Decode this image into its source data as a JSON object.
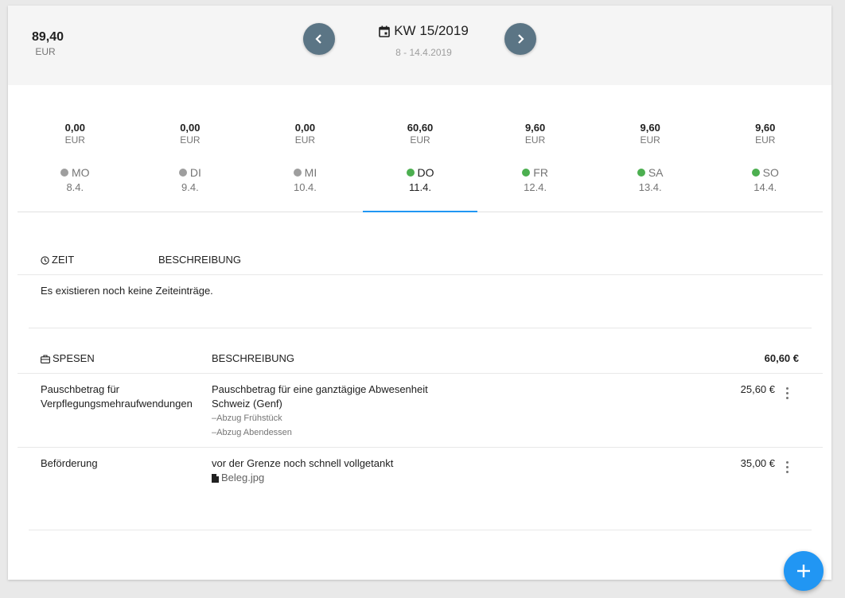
{
  "header": {
    "total_amount": "89,40",
    "total_currency": "EUR",
    "week_title": "KW 15/2019",
    "week_range": "8 - 14.4.2019"
  },
  "days": [
    {
      "amount": "0,00",
      "currency": "EUR",
      "name": "MO",
      "date": "8.4.",
      "status_color": "#9e9e9e"
    },
    {
      "amount": "0,00",
      "currency": "EUR",
      "name": "DI",
      "date": "9.4.",
      "status_color": "#9e9e9e"
    },
    {
      "amount": "0,00",
      "currency": "EUR",
      "name": "MI",
      "date": "10.4.",
      "status_color": "#9e9e9e"
    },
    {
      "amount": "60,60",
      "currency": "EUR",
      "name": "DO",
      "date": "11.4.",
      "status_color": "#4caf50"
    },
    {
      "amount": "9,60",
      "currency": "EUR",
      "name": "FR",
      "date": "12.4.",
      "status_color": "#4caf50"
    },
    {
      "amount": "9,60",
      "currency": "EUR",
      "name": "SA",
      "date": "13.4.",
      "status_color": "#4caf50"
    },
    {
      "amount": "9,60",
      "currency": "EUR",
      "name": "SO",
      "date": "14.4.",
      "status_color": "#4caf50"
    }
  ],
  "active_day": "DO",
  "time_section": {
    "col_time": "ZEIT",
    "col_description": "BESCHREIBUNG",
    "empty_text": "Es existieren noch keine Zeiteinträge."
  },
  "expenses_section": {
    "col_expenses": "SPESEN",
    "col_description": "BESCHREIBUNG",
    "total": "60,60 €",
    "rows": [
      {
        "type_line1": "Pauschbetrag für",
        "type_line2": "Verpflegungsmehraufwendungen",
        "desc_line1": "Pauschbetrag für eine ganztägige Abwesenheit",
        "desc_line2": "Schweiz (Genf)",
        "note1": "–Abzug Frühstück",
        "note2": "–Abzug Abendessen",
        "amount": "25,60 €"
      },
      {
        "type_line1": "Beförderung",
        "desc_line1": "vor der Grenze noch schnell vollgetankt",
        "attachment": "Beleg.jpg",
        "amount": "35,00 €"
      }
    ]
  },
  "colors": {
    "accent": "#2196f3",
    "nav_button": "#5b7585",
    "status_inactive": "#9e9e9e",
    "status_active": "#4caf50"
  }
}
